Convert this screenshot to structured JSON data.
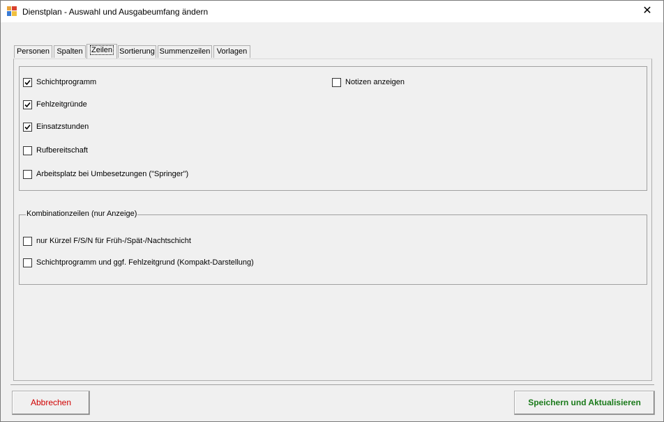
{
  "window": {
    "title": "Dienstplan - Auswahl und Ausgabeumfang  ändern",
    "close_glyph": "✕",
    "app_icon": "dienstplan-app-icon"
  },
  "tabs": [
    {
      "label": "Personen",
      "active": false
    },
    {
      "label": "Spalten",
      "active": false
    },
    {
      "label": "Zeilen",
      "active": true
    },
    {
      "label": "Sortierung",
      "active": false
    },
    {
      "label": "Summenzeilen",
      "active": false
    },
    {
      "label": "Vorlagen",
      "active": false
    }
  ],
  "rows_group": {
    "items": [
      {
        "label": "Schichtprogramm",
        "checked": true
      },
      {
        "label": "Fehlzeitgründe",
        "checked": true
      },
      {
        "label": "Einsatzstunden",
        "checked": true
      },
      {
        "label": "Rufbereitschaft",
        "checked": false
      },
      {
        "label": "Arbeitsplatz bei Umbesetzungen (\"Springer\")",
        "checked": false
      },
      {
        "label": "Notizen anzeigen",
        "checked": false
      }
    ]
  },
  "combo_group": {
    "legend": "Kombinationzeilen (nur Anzeige)",
    "items": [
      {
        "label": "nur Kürzel F/S/N für Früh-/Spät-/Nachtschicht",
        "checked": false
      },
      {
        "label": "Schichtprogramm und ggf. Fehlzeitgrund (Kompakt-Darstellung)",
        "checked": false
      }
    ]
  },
  "buttons": {
    "cancel": "Abbrechen",
    "save": "Speichern und Aktualisieren"
  },
  "colors": {
    "cancel_text": "#d00000",
    "save_text": "#1a7a1a"
  }
}
